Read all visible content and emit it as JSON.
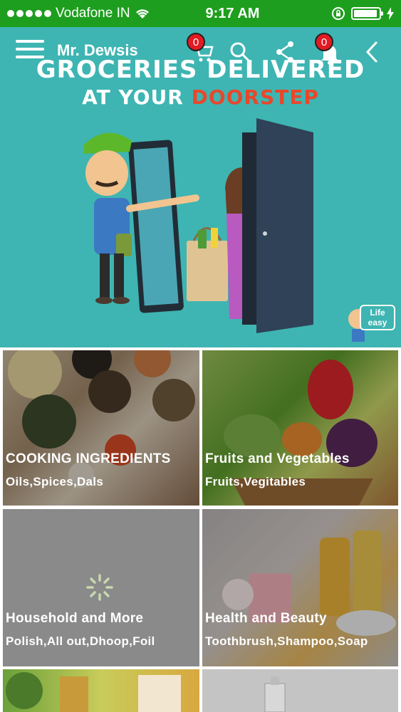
{
  "status_bar": {
    "carrier": "Vodafone IN",
    "time": "9:17 AM",
    "battery_level": 0.95
  },
  "header": {
    "title": "Mr. Dewsis",
    "cart_count": "0",
    "notification_count": "0"
  },
  "banner": {
    "line1": "GROCERIES DELIVERED",
    "line2_a": "AT YOUR",
    "line2_b": "DOORSTEP"
  },
  "categories": [
    {
      "title": "COOKING INGREDIENTS",
      "subtitle": "Oils,Spices,Dals"
    },
    {
      "title": "Fruits and Vegetables",
      "subtitle": "Fruits,Vegitables"
    },
    {
      "title": "Household and More",
      "subtitle": "Polish,All out,Dhoop,Foil"
    },
    {
      "title": "Health and Beauty",
      "subtitle": "Toothbrush,Shampoo,Soap"
    }
  ],
  "colors": {
    "status_bar": "#1e9e1e",
    "banner_bg": "#3eb5b2",
    "badge": "#e21b23",
    "accent_red": "#e9472b"
  },
  "icons": [
    "menu-icon",
    "cart-icon",
    "search-icon",
    "share-icon",
    "bell-icon",
    "back-icon",
    "wifi-icon",
    "lock-rotation-icon",
    "battery-icon",
    "charging-icon",
    "loading-spinner-icon"
  ]
}
